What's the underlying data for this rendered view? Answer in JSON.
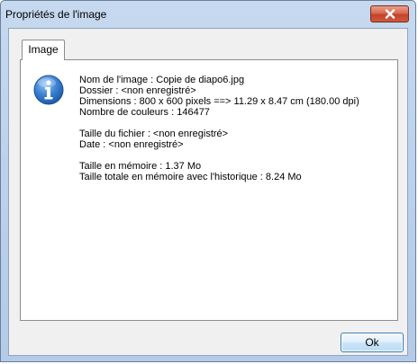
{
  "window": {
    "title": "Propriétés de l'image"
  },
  "tabs": [
    {
      "label": "Image",
      "selected": true
    }
  ],
  "info": {
    "icon": "info-icon",
    "lines": [
      "Nom de l'image : Copie de diapo6.jpg",
      "Dossier : <non enregistré>",
      "Dimensions : 800 x 600 pixels ==> 11.29 x 8.47 cm  (180.00 dpi)",
      "Nombre de couleurs : 146477",
      "",
      "Taille du fichier : <non enregistré>",
      "Date : <non enregistré>",
      "",
      "Taille en mémoire : 1.37 Mo",
      "Taille totale en mémoire avec l'historique : 8.24 Mo"
    ]
  },
  "buttons": {
    "ok_label": "Ok",
    "close_icon": "close-icon"
  },
  "colors": {
    "titlebar": "#c6d9ef",
    "close_button": "#c9472e",
    "info_icon": "#2f6fc0"
  }
}
